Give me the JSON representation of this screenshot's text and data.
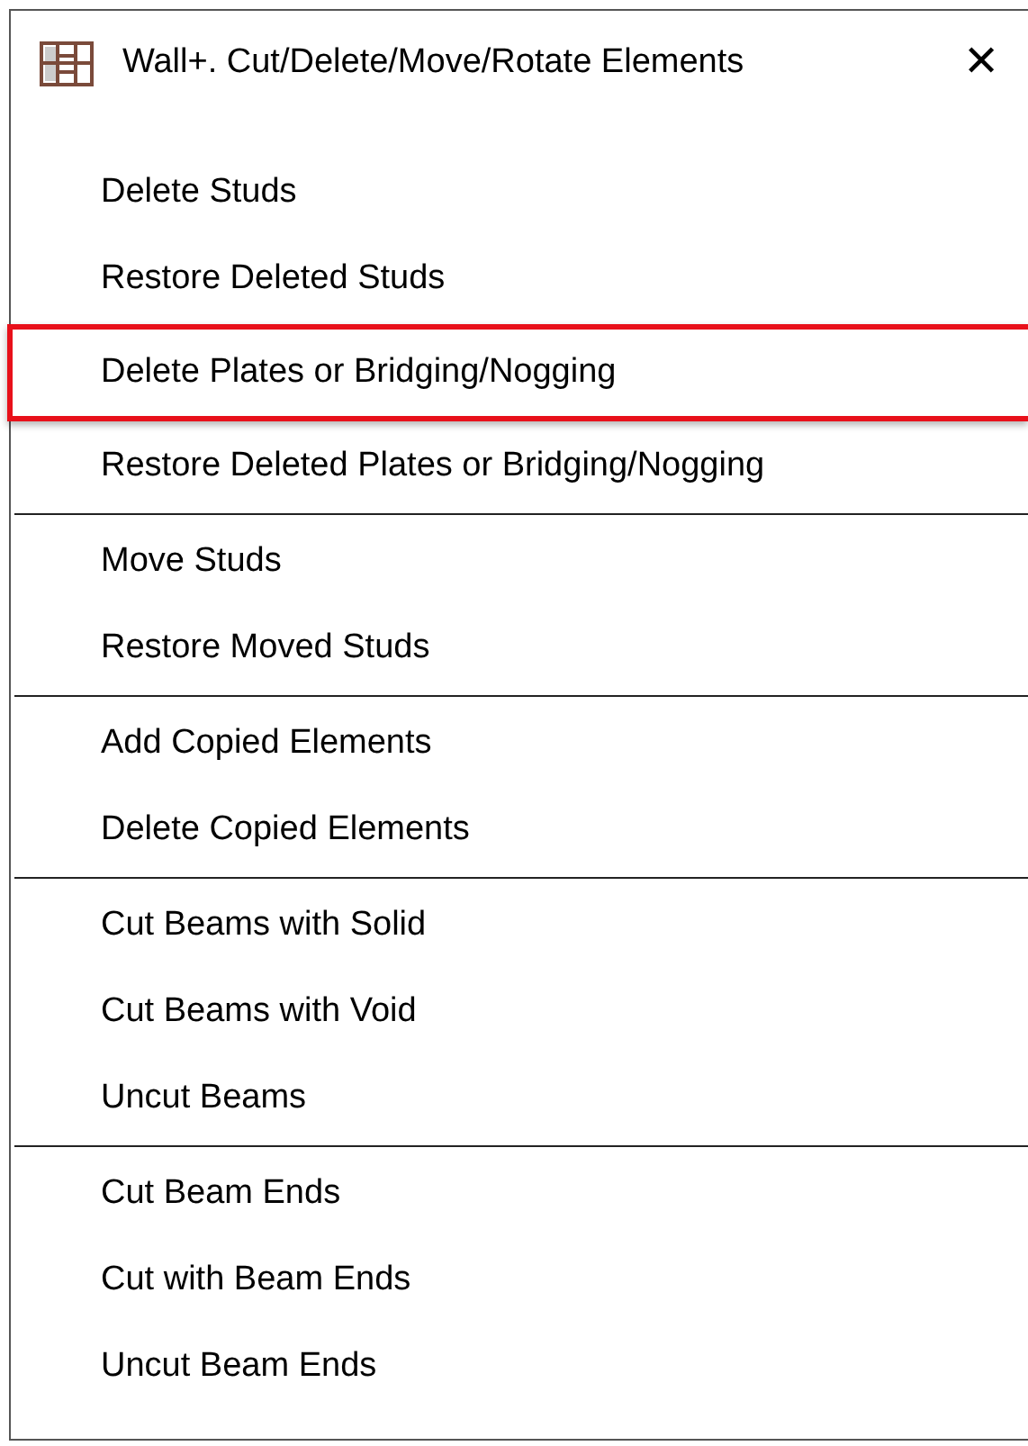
{
  "window": {
    "title": "Wall+. Cut/Delete/Move/Rotate Elements",
    "close": "✕"
  },
  "groups": [
    {
      "items": [
        {
          "label": "Delete Studs",
          "selected": false
        },
        {
          "label": "Restore Deleted Studs",
          "selected": false
        },
        {
          "label": "Delete Plates or Bridging/Nogging",
          "selected": true
        },
        {
          "label": "Restore Deleted Plates or Bridging/Nogging",
          "selected": false
        }
      ]
    },
    {
      "items": [
        {
          "label": "Move Studs",
          "selected": false
        },
        {
          "label": "Restore Moved Studs",
          "selected": false
        }
      ]
    },
    {
      "items": [
        {
          "label": "Add Copied Elements",
          "selected": false
        },
        {
          "label": "Delete Copied Elements",
          "selected": false
        }
      ]
    },
    {
      "items": [
        {
          "label": "Cut Beams with Solid",
          "selected": false
        },
        {
          "label": "Cut Beams with Void",
          "selected": false
        },
        {
          "label": "Uncut Beams",
          "selected": false
        }
      ]
    },
    {
      "items": [
        {
          "label": "Cut Beam Ends",
          "selected": false
        },
        {
          "label": "Cut with Beam Ends",
          "selected": false
        },
        {
          "label": "Uncut Beam Ends",
          "selected": false
        }
      ]
    }
  ]
}
